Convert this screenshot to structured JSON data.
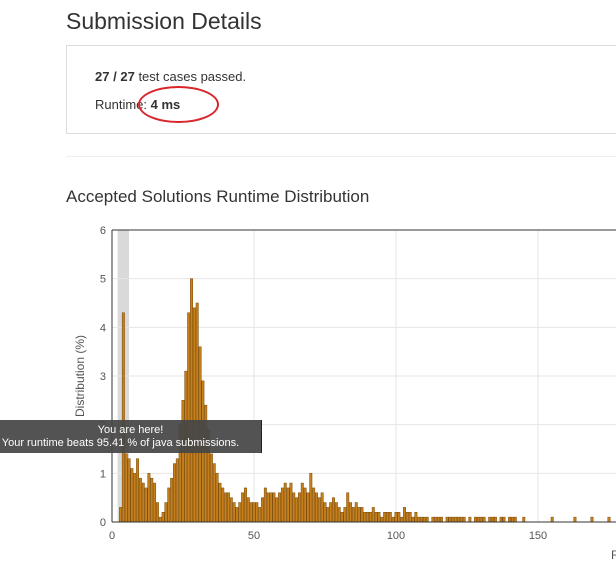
{
  "page": {
    "title": "Submission Details"
  },
  "details": {
    "passed": "27",
    "separator": "/",
    "total": "27",
    "passed_suffix": "test cases passed.",
    "runtime_label": "Runtime:",
    "runtime_value": "4 ms"
  },
  "chart_section": {
    "title": "Accepted Solutions Runtime Distribution"
  },
  "tooltip": {
    "line1": "You are here!",
    "line2": "Your runtime beats 95.41 % of java submissions."
  },
  "colors": {
    "bar": "#c57f1b",
    "bar_edge": "#7a4a0c",
    "highlight": "#d9d9d9",
    "annotation": "#d9262c"
  },
  "chart_data": {
    "type": "bar",
    "ylabel": "Distribution (%)",
    "xlabel": "R",
    "ylim": [
      0,
      6
    ],
    "xlim": [
      0,
      175
    ],
    "x_ticks": [
      0,
      50,
      100,
      150
    ],
    "y_ticks": [
      0,
      1,
      2,
      3,
      4,
      5,
      6
    ],
    "highlight_x": [
      2,
      6
    ],
    "x": [
      3,
      4,
      5,
      6,
      7,
      8,
      9,
      10,
      11,
      12,
      13,
      14,
      15,
      16,
      17,
      18,
      19,
      20,
      21,
      22,
      23,
      24,
      25,
      26,
      27,
      28,
      29,
      30,
      31,
      32,
      33,
      34,
      35,
      36,
      37,
      38,
      39,
      40,
      41,
      42,
      43,
      44,
      45,
      46,
      47,
      48,
      49,
      50,
      51,
      52,
      53,
      54,
      55,
      56,
      57,
      58,
      59,
      60,
      61,
      62,
      63,
      64,
      65,
      66,
      67,
      68,
      69,
      70,
      71,
      72,
      73,
      74,
      75,
      76,
      77,
      78,
      79,
      80,
      81,
      82,
      83,
      84,
      85,
      86,
      87,
      88,
      89,
      90,
      91,
      92,
      93,
      94,
      95,
      96,
      97,
      98,
      99,
      100,
      101,
      102,
      103,
      104,
      105,
      106,
      107,
      108,
      109,
      110,
      111,
      112,
      113,
      114,
      115,
      116,
      117,
      118,
      119,
      120,
      121,
      122,
      123,
      124,
      125,
      126,
      127,
      128,
      129,
      130,
      131,
      132,
      133,
      134,
      135,
      136,
      137,
      138,
      139,
      140,
      141,
      142,
      143,
      144,
      145,
      146,
      147,
      148,
      149,
      150,
      151,
      152,
      153,
      154,
      155,
      156,
      157,
      158,
      159,
      160,
      161,
      162,
      163,
      164,
      165,
      166,
      167,
      168,
      169,
      170,
      171,
      172,
      173,
      174,
      175
    ],
    "values": [
      0.3,
      4.3,
      1.4,
      1.3,
      1.1,
      1.0,
      1.3,
      0.9,
      0.8,
      0.7,
      1.0,
      0.9,
      0.8,
      0.4,
      0.1,
      0.2,
      0.4,
      0.7,
      0.9,
      1.2,
      1.3,
      2.0,
      2.5,
      3.1,
      4.3,
      5.0,
      4.4,
      4.5,
      3.6,
      2.9,
      2.4,
      1.9,
      1.4,
      1.2,
      1.0,
      0.8,
      0.7,
      0.6,
      0.6,
      0.5,
      0.4,
      0.3,
      0.4,
      0.6,
      0.7,
      0.5,
      0.4,
      0.4,
      0.4,
      0.3,
      0.5,
      0.7,
      0.6,
      0.6,
      0.6,
      0.5,
      0.6,
      0.7,
      0.8,
      0.7,
      0.8,
      0.6,
      0.5,
      0.6,
      0.8,
      0.7,
      0.6,
      1.0,
      0.7,
      0.6,
      0.5,
      0.6,
      0.4,
      0.3,
      0.4,
      0.5,
      0.4,
      0.3,
      0.2,
      0.3,
      0.6,
      0.4,
      0.3,
      0.4,
      0.3,
      0.3,
      0.2,
      0.2,
      0.2,
      0.3,
      0.2,
      0.2,
      0.1,
      0.2,
      0.2,
      0.2,
      0.1,
      0.2,
      0.2,
      0.1,
      0.3,
      0.2,
      0.2,
      0.1,
      0.2,
      0.1,
      0.1,
      0.1,
      0.1,
      0.0,
      0.1,
      0.1,
      0.1,
      0.1,
      0.0,
      0.1,
      0.1,
      0.1,
      0.1,
      0.1,
      0.1,
      0.1,
      0.0,
      0.1,
      0.0,
      0.1,
      0.1,
      0.1,
      0.1,
      0.0,
      0.1,
      0.1,
      0.1,
      0.0,
      0.1,
      0.1,
      0.0,
      0.1,
      0.1,
      0.1,
      0.0,
      0.0,
      0.1,
      0.0,
      0.0,
      0.0,
      0.0,
      0.0,
      0.0,
      0.0,
      0.0,
      0.0,
      0.1,
      0.0,
      0.0,
      0.0,
      0.0,
      0.0,
      0.0,
      0.0,
      0.1,
      0.0,
      0.0,
      0.0,
      0.0,
      0.0,
      0.1,
      0.0,
      0.0,
      0.0,
      0.0,
      0.0,
      0.1
    ]
  }
}
